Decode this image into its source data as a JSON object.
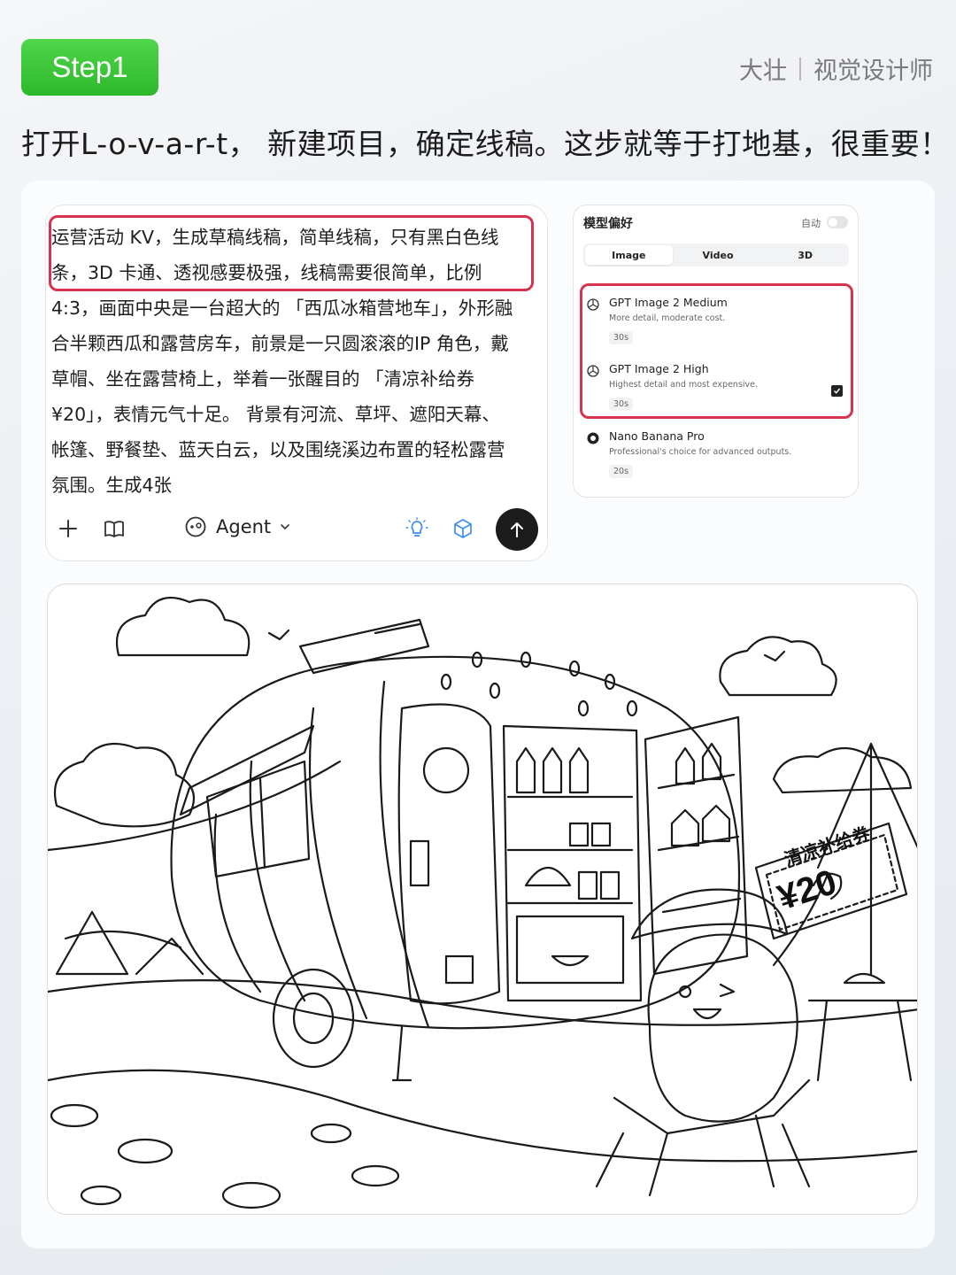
{
  "header": {
    "step_label": "Step1",
    "author_name": "大壮",
    "author_title": "视觉设计师",
    "headline": "打开L-o-v-a-r-t， 新建项目，确定线稿。这步就等于打地基，很重要！"
  },
  "prompt_box": {
    "lines": [
      "运营活动 KV，生成草稿线稿，简单线稿，只有黑白色线",
      "条，3D 卡通、透视感要极强，线稿需要很简单，比例",
      "4:3，画面中央是一台超大的 「西瓜冰箱营地车」，外形融",
      "合半颗西瓜和露营房车，前景是一只圆滚滚的IP 角色，戴",
      "草帽、坐在露营椅上，举着一张醒目的 「清凉补给券",
      "¥20」，表情元气十足。 背景有河流、草坪、遮阳天幕、",
      "帐篷、野餐垫、蓝天白云，以及围绕溪边布置的轻松露营",
      "氛围。生成4张"
    ],
    "toolbar": {
      "agent_label": "Agent"
    }
  },
  "model_panel": {
    "title": "模型偏好",
    "auto_label": "自动",
    "tabs": [
      "Image",
      "Video",
      "3D"
    ],
    "active_tab": "Image",
    "models": [
      {
        "name": "GPT Image 2 Medium",
        "desc": "More detail, moderate cost.",
        "time": "30s",
        "checked": false
      },
      {
        "name": "GPT Image 2 High",
        "desc": "Highest detail and most expensive.",
        "time": "30s",
        "checked": true
      },
      {
        "name": "Nano Banana Pro",
        "desc": "Professional's choice for advanced outputs.",
        "time": "20s",
        "checked": false
      }
    ]
  },
  "sketch": {
    "coupon_title": "清凉补给券",
    "coupon_value": "¥20"
  },
  "colors": {
    "badge_green": "#34c02f",
    "highlight_red": "#d6334f",
    "send_button": "#1c1c1c",
    "icon_blue": "#3d8ef0"
  }
}
